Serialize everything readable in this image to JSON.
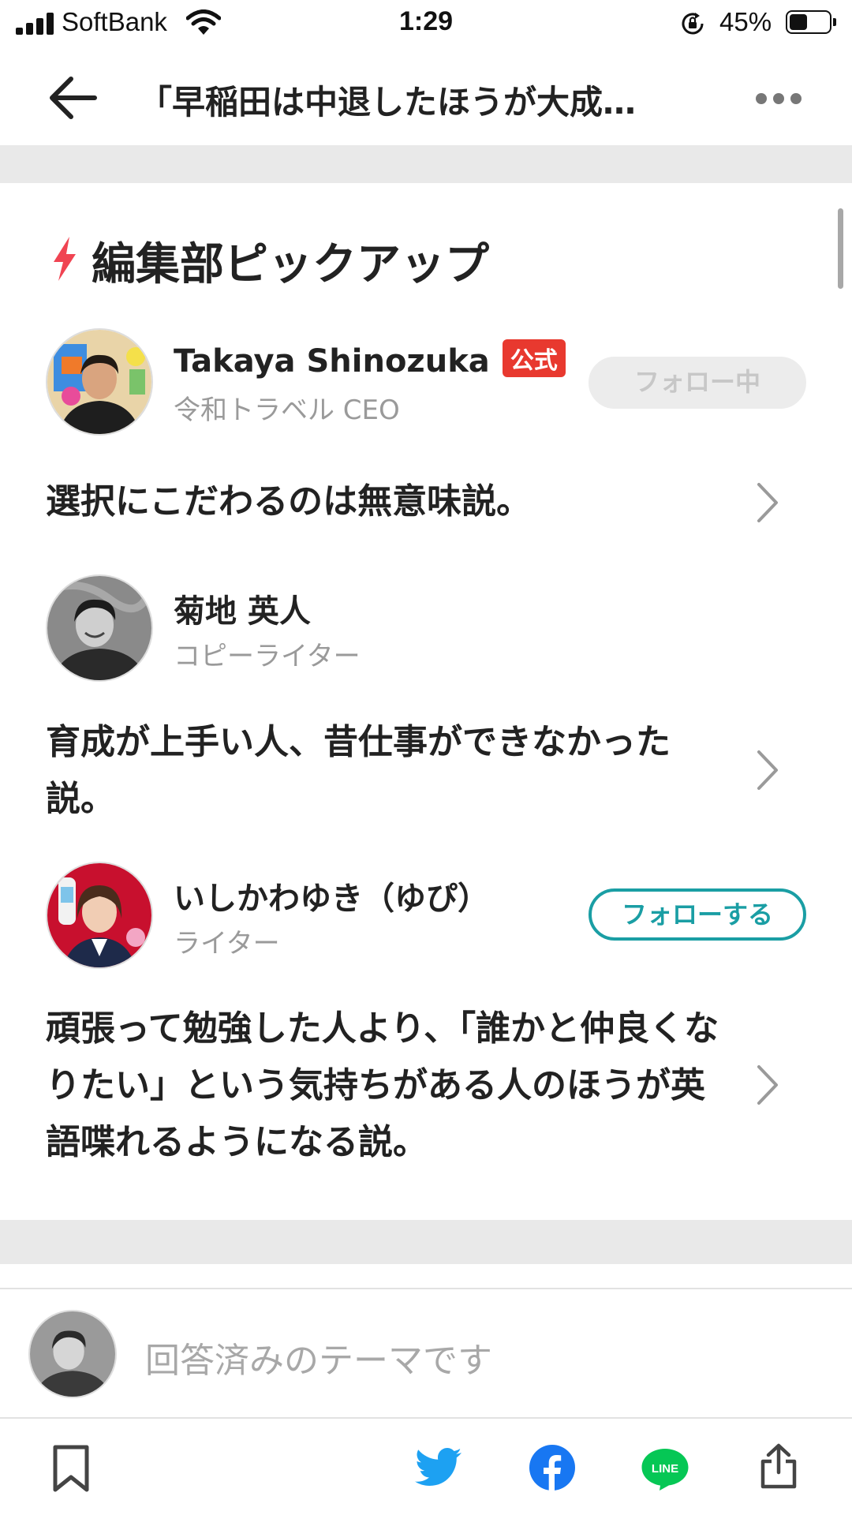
{
  "status_bar": {
    "carrier": "SoftBank",
    "time": "1:29",
    "battery_percent": "45%",
    "battery_level": 0.45,
    "icons": [
      "cellular-signal-icon",
      "wifi-icon",
      "rotation-lock-icon",
      "battery-icon"
    ]
  },
  "header": {
    "title": "「早稲田は中退したほうが大成…",
    "icons": [
      "back-arrow-icon",
      "more-icon"
    ]
  },
  "section": {
    "title": "編集部ピックアップ",
    "icon": "lightning-icon",
    "accent_color": "#f04452"
  },
  "picks": [
    {
      "author_name": "Takaya Shinozuka",
      "badge": "公式",
      "role": "令和トラベル CEO",
      "follow_label": "フォロー中",
      "text": "選択にこだわるのは無意味説。"
    },
    {
      "author_name": "菊地 英人",
      "role": "コピーライター",
      "text": "育成が上手い人、昔仕事ができなかった説。"
    },
    {
      "author_name": "いしかわゆき（ゆぴ）",
      "role": "ライター",
      "follow_label": "フォローする",
      "text": "頑張って勉強した人より、「誰かと仲良くなりたい」という気持ちがある人のほうが英語喋れるようになる説。"
    }
  ],
  "comment": {
    "placeholder": "回答済みのテーマです"
  },
  "bottom_bar": {
    "icons": [
      "bookmark-icon",
      "twitter-icon",
      "facebook-icon",
      "line-icon",
      "share-icon"
    ],
    "line_label": "LINE",
    "colors": {
      "twitter": "#1da1f2",
      "facebook": "#1877f2",
      "line": "#06c755"
    }
  },
  "colors": {
    "badge_red": "#e8392f",
    "follow_teal": "#1a9ea4",
    "separator_gray": "#e9e9e9"
  }
}
